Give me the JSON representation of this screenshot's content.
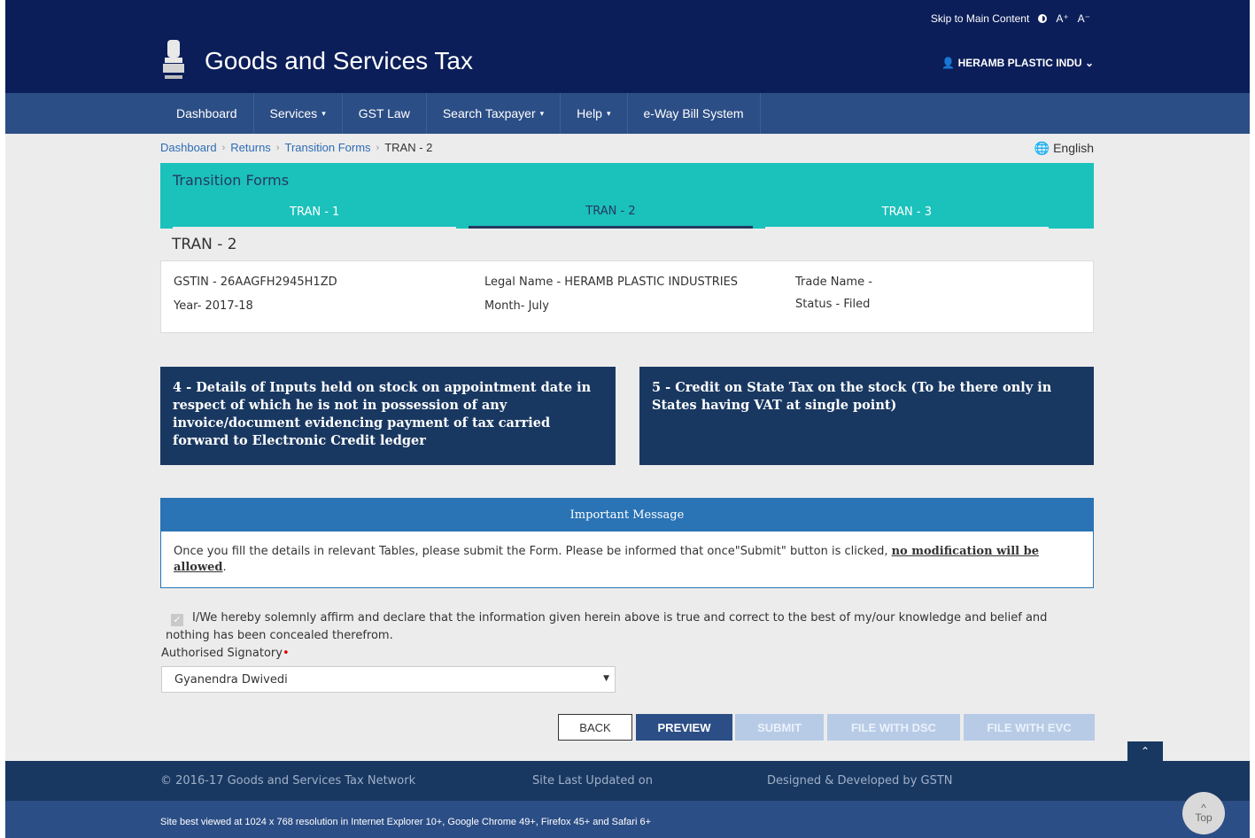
{
  "topbar": {
    "skip_link": "Skip to Main Content",
    "font_increase": "A⁺",
    "font_decrease": "A⁻"
  },
  "header": {
    "title": "Goods and Services Tax",
    "user": "HERAMB PLASTIC INDU"
  },
  "nav": [
    "Dashboard",
    "Services",
    "GST Law",
    "Search Taxpayer",
    "Help",
    "e-Way Bill System"
  ],
  "nav_caret": [
    "",
    "▾",
    "",
    "▾",
    "▾",
    ""
  ],
  "breadcrumb": {
    "items": [
      "Dashboard",
      "Returns",
      "Transition Forms"
    ],
    "current": "TRAN - 2",
    "separator": "›"
  },
  "language": "English",
  "transition": {
    "title": "Transition Forms",
    "tabs": [
      "TRAN - 1",
      "TRAN - 2",
      "TRAN - 3"
    ],
    "active_tab": "TRAN - 2"
  },
  "section_title": "TRAN - 2",
  "info": {
    "gstin": "GSTIN - 26AAGFH2945H1ZD",
    "legal_name": "Legal Name - HERAMB PLASTIC INDUSTRIES",
    "trade_name": "Trade Name -",
    "year": "Year- 2017-18",
    "month": "Month- July",
    "status": "Status - Filed"
  },
  "tiles": [
    "4 - Details of Inputs held on stock on appointment date in respect of which he is not in possession of any invoice/document evidencing payment of tax carried forward to Electronic Credit ledger",
    "5 - Credit on State Tax on the stock (To be there only in States having VAT at single point)"
  ],
  "message": {
    "title": "Important Message",
    "text": "Once you fill the details in relevant Tables, please submit the Form. Please be informed that once\"Submit\" button is clicked, ",
    "emphasis": "no modification will be allowed",
    "end": "."
  },
  "declaration": "I/We hereby solemnly affirm and declare that the information given herein above is true and correct to the best of my/our knowledge and belief and nothing has been concealed therefrom.",
  "signatory": {
    "label": "Authorised Signatory",
    "value": "Gyanendra Dwivedi"
  },
  "buttons": {
    "back": "BACK",
    "preview": "PREVIEW",
    "submit": "SUBMIT",
    "dsc": "FILE WITH DSC",
    "evc": "FILE WITH EVC"
  },
  "footer": {
    "copyright": "© 2016-17 Goods and Services Tax Network",
    "updated": "Site Last Updated on",
    "designed": "Designed & Developed by GSTN",
    "best_viewed": "Site best viewed at 1024 x 768 resolution in Internet Explorer 10+, Google Chrome 49+, Firefox 45+ and Safari 6+",
    "top": "Top"
  },
  "colors": {
    "navy": "#0b1e59",
    "nav": "#2c4e86",
    "teal": "#1bc1bb",
    "tile": "#193861",
    "msg": "#2a73b5"
  }
}
